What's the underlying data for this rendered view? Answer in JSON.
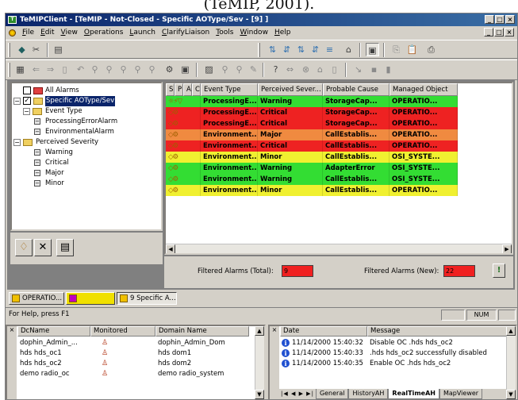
{
  "caption_text": "(TeMIP, 2001).",
  "window": {
    "title": "TeMIPClient - [TeMIP - Not-Closed - Specific AOType/Sev - [9] ]",
    "app_icon": "T",
    "controls": [
      "_",
      "□",
      "×"
    ]
  },
  "menu": [
    "File",
    "Edit",
    "View",
    "Operations",
    "Launch",
    "ClarifyLiaison",
    "Tools",
    "Window",
    "Help"
  ],
  "tree": {
    "items": [
      {
        "label": "All Alarms",
        "level": 0,
        "checked": false,
        "icon": "folder-red"
      },
      {
        "label": "Specific AOType/Sev",
        "level": 0,
        "checked": true,
        "icon": "folder-yellow",
        "selected": true
      },
      {
        "label": "Event Type",
        "level": 1,
        "icon": "folder-yellow"
      },
      {
        "label": "ProcessingErrorAlarm",
        "level": 2,
        "icon": "leaf"
      },
      {
        "label": "EnvironmentalAlarm",
        "level": 2,
        "icon": "leaf"
      },
      {
        "label": "Perceived Severity",
        "level": 1,
        "icon": "folder-yellow"
      },
      {
        "label": "Warning",
        "level": 2,
        "icon": "leaf"
      },
      {
        "label": "Critical",
        "level": 2,
        "icon": "leaf"
      },
      {
        "label": "Major",
        "level": 2,
        "icon": "leaf"
      },
      {
        "label": "Minor",
        "level": 2,
        "icon": "leaf"
      }
    ]
  },
  "grid": {
    "columns": [
      "S",
      "P",
      "A",
      "C",
      "Event Type",
      "Perceived Sever...",
      "Probable Cause",
      "Managed Object"
    ],
    "rows": [
      {
        "icons": "☼⚡▽",
        "event": "ProcessingE...",
        "severity": "Warning",
        "cause": "StorageCap...",
        "object": "OPERATIO...",
        "color": "#33dd33"
      },
      {
        "icons": "◇⚙",
        "event": "ProcessingE...",
        "severity": "Critical",
        "cause": "StorageCap...",
        "object": "OPERATIO...",
        "color": "#ee2222"
      },
      {
        "icons": "◇⚙",
        "event": "ProcessingE...",
        "severity": "Critical",
        "cause": "StorageCap...",
        "object": "OPERATIO...",
        "color": "#ee2222"
      },
      {
        "icons": "◇⚙",
        "event": "Environment...",
        "severity": "Major",
        "cause": "CallEstablis...",
        "object": "OPERATIO...",
        "color": "#f08a40"
      },
      {
        "icons": "◇⚙",
        "event": "Environment...",
        "severity": "Critical",
        "cause": "CallEstablis...",
        "object": "OPERATIO...",
        "color": "#ee2222"
      },
      {
        "icons": "◇⚙",
        "event": "Environment...",
        "severity": "Minor",
        "cause": "CallEstablis...",
        "object": "OSI_SYSTE...",
        "color": "#f0f030"
      },
      {
        "icons": "◇⚙",
        "event": "Environment...",
        "severity": "Warning",
        "cause": "AdapterError",
        "object": "OSI_SYSTE...",
        "color": "#33dd33"
      },
      {
        "icons": "◇⚙",
        "event": "Environment...",
        "severity": "Warning",
        "cause": "CallEstablis...",
        "object": "OSI_SYSTE...",
        "color": "#33dd33"
      },
      {
        "icons": "◇⚙",
        "event": "Environment...",
        "severity": "Minor",
        "cause": "CallEstablis...",
        "object": "OPERATIO...",
        "color": "#f0f030"
      }
    ]
  },
  "filter": {
    "total_label": "Filtered Alarms (Total):",
    "total_value": "9",
    "new_label": "Filtered Alarms (New):",
    "new_value": "22"
  },
  "tasks": [
    {
      "label": "OPERATIO...",
      "active": false
    },
    {
      "label": "",
      "active": false
    },
    {
      "label": "9 Specific A...",
      "active": true
    }
  ],
  "status": {
    "help": "For Help, press F1",
    "num": "NUM"
  },
  "left_table": {
    "headers": [
      "DcName",
      "Monitored",
      "Domain Name"
    ],
    "rows": [
      {
        "dc": "dophin_Admin_...",
        "domain": "dophin_Admin_Dom"
      },
      {
        "dc": "hds hds_oc1",
        "domain": "hds dom1"
      },
      {
        "dc": "hds hds_oc2",
        "domain": "hds dom2"
      },
      {
        "dc": "demo radio_oc",
        "domain": "demo radio_system"
      }
    ]
  },
  "log": {
    "headers": [
      "Date",
      "Message"
    ],
    "rows": [
      {
        "date": "11/14/2000 15:40:32",
        "message": "Disable OC .hds hds_oc2"
      },
      {
        "date": "11/14/2000 15:40:33",
        "message": ".hds hds_oc2 successfully disabled"
      },
      {
        "date": "11/14/2000 15:40:35",
        "message": "Enable OC .hds hds_oc2"
      }
    ],
    "tabs": [
      {
        "label": "General",
        "active": false
      },
      {
        "label": "HistoryAH",
        "active": false
      },
      {
        "label": "RealTimeAH",
        "active": true
      },
      {
        "label": "MapViewer",
        "active": false
      }
    ],
    "nav": "|◀ ◀ ▶ ▶|"
  },
  "colors": {
    "green": "#33dd33",
    "red": "#ee2222",
    "orange": "#f08a40",
    "yellow": "#f0f030",
    "title_blue": "#0a246a"
  }
}
